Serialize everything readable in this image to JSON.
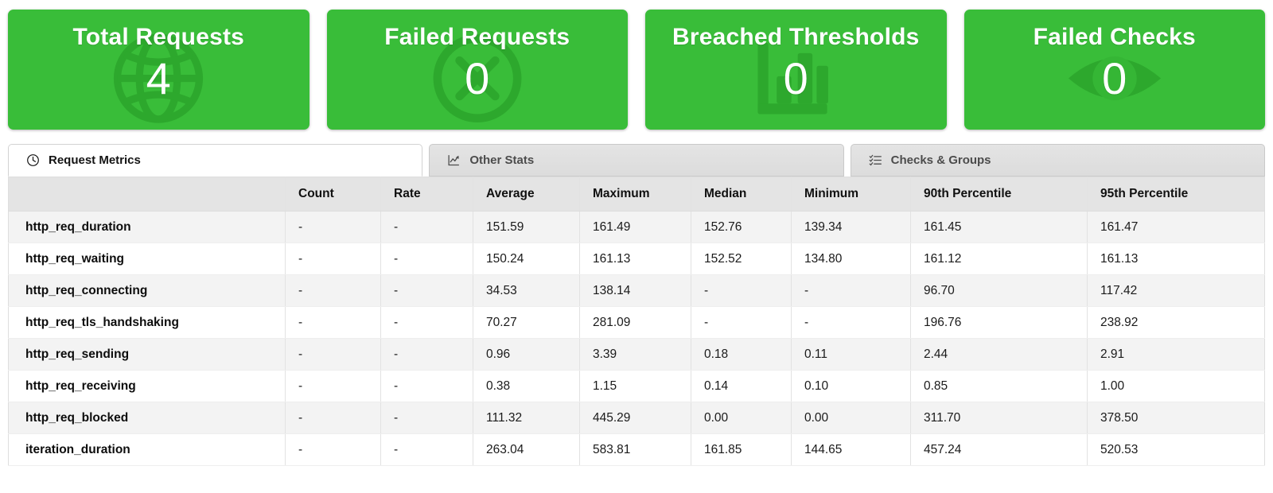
{
  "summary_cards": [
    {
      "title": "Total Requests",
      "value": "4",
      "icon": "globe-icon",
      "bg_color": "#39bd39",
      "watermark_color": "#2da82d"
    },
    {
      "title": "Failed Requests",
      "value": "0",
      "icon": "circle-x-icon",
      "bg_color": "#39bd39",
      "watermark_color": "#2da82d"
    },
    {
      "title": "Breached Thresholds",
      "value": "0",
      "icon": "bar-chart-icon",
      "bg_color": "#39bd39",
      "watermark_color": "#2da82d"
    },
    {
      "title": "Failed Checks",
      "value": "0",
      "icon": "eye-icon",
      "bg_color": "#39bd39",
      "watermark_color": "#2da82d"
    }
  ],
  "tabs": [
    {
      "label": "Request Metrics",
      "icon": "clock-icon",
      "active": true
    },
    {
      "label": "Other Stats",
      "icon": "line-chart-icon",
      "active": false
    },
    {
      "label": "Checks & Groups",
      "icon": "task-list-icon",
      "active": false
    }
  ],
  "table": {
    "columns": [
      "",
      "Count",
      "Rate",
      "Average",
      "Maximum",
      "Median",
      "Minimum",
      "90th Percentile",
      "95th Percentile"
    ],
    "rows": [
      {
        "name": "http_req_duration",
        "count": "-",
        "rate": "-",
        "average": "151.59",
        "maximum": "161.49",
        "median": "152.76",
        "minimum": "139.34",
        "p90": "161.45",
        "p95": "161.47"
      },
      {
        "name": "http_req_waiting",
        "count": "-",
        "rate": "-",
        "average": "150.24",
        "maximum": "161.13",
        "median": "152.52",
        "minimum": "134.80",
        "p90": "161.12",
        "p95": "161.13"
      },
      {
        "name": "http_req_connecting",
        "count": "-",
        "rate": "-",
        "average": "34.53",
        "maximum": "138.14",
        "median": "-",
        "minimum": "-",
        "p90": "96.70",
        "p95": "117.42"
      },
      {
        "name": "http_req_tls_handshaking",
        "count": "-",
        "rate": "-",
        "average": "70.27",
        "maximum": "281.09",
        "median": "-",
        "minimum": "-",
        "p90": "196.76",
        "p95": "238.92"
      },
      {
        "name": "http_req_sending",
        "count": "-",
        "rate": "-",
        "average": "0.96",
        "maximum": "3.39",
        "median": "0.18",
        "minimum": "0.11",
        "p90": "2.44",
        "p95": "2.91"
      },
      {
        "name": "http_req_receiving",
        "count": "-",
        "rate": "-",
        "average": "0.38",
        "maximum": "1.15",
        "median": "0.14",
        "minimum": "0.10",
        "p90": "0.85",
        "p95": "1.00"
      },
      {
        "name": "http_req_blocked",
        "count": "-",
        "rate": "-",
        "average": "111.32",
        "maximum": "445.29",
        "median": "0.00",
        "minimum": "0.00",
        "p90": "311.70",
        "p95": "378.50"
      },
      {
        "name": "iteration_duration",
        "count": "-",
        "rate": "-",
        "average": "263.04",
        "maximum": "583.81",
        "median": "161.85",
        "minimum": "144.65",
        "p90": "457.24",
        "p95": "520.53"
      }
    ]
  }
}
